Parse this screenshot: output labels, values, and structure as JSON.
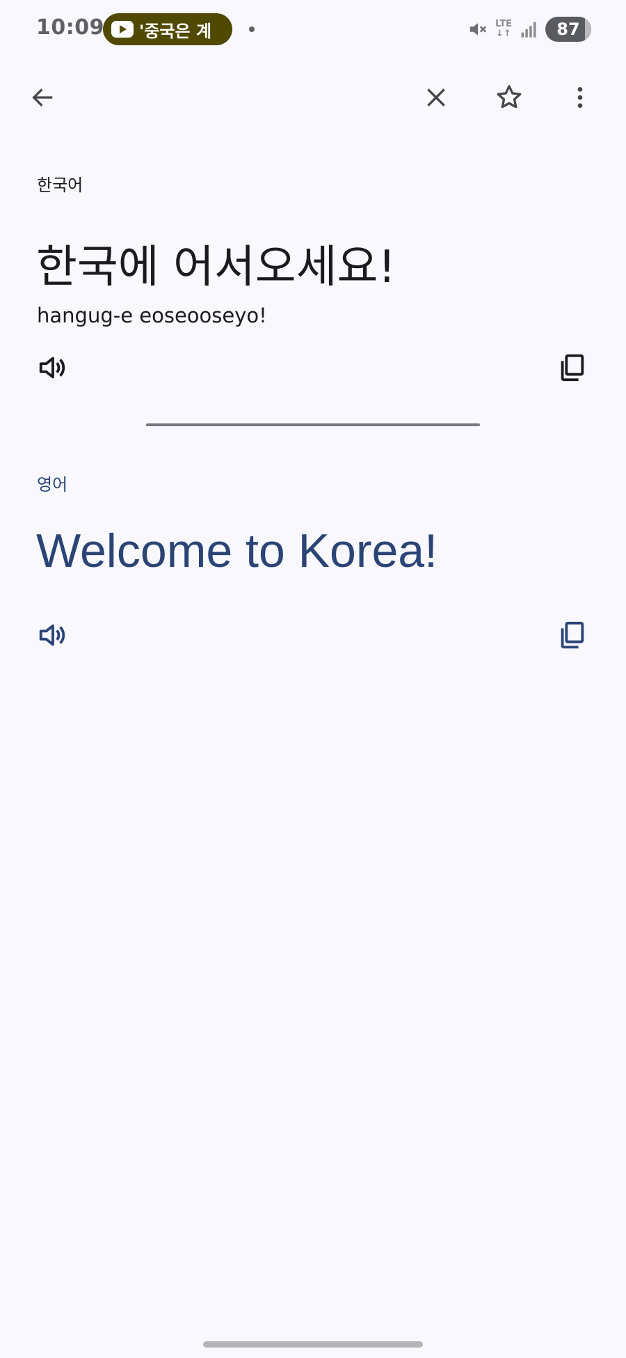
{
  "status_bar": {
    "time": "10:09",
    "media_text": "'중국은 계",
    "network": "LTE",
    "battery": "87"
  },
  "app_bar": {
    "back_icon": "arrow-back-icon",
    "close_icon": "close-icon",
    "star_icon": "star-outline-icon",
    "more_icon": "more-vert-icon"
  },
  "source": {
    "language": "한국어",
    "text": "한국에 어서오세요!",
    "transliteration": "hangug-e eoseooseyo!"
  },
  "target": {
    "language": "영어",
    "text": "Welcome to Korea!"
  },
  "colors": {
    "background": "#f8f8fe",
    "source_text": "#1b1b1f",
    "target_text": "#2b4476",
    "media_pill": "#4f4a00"
  }
}
